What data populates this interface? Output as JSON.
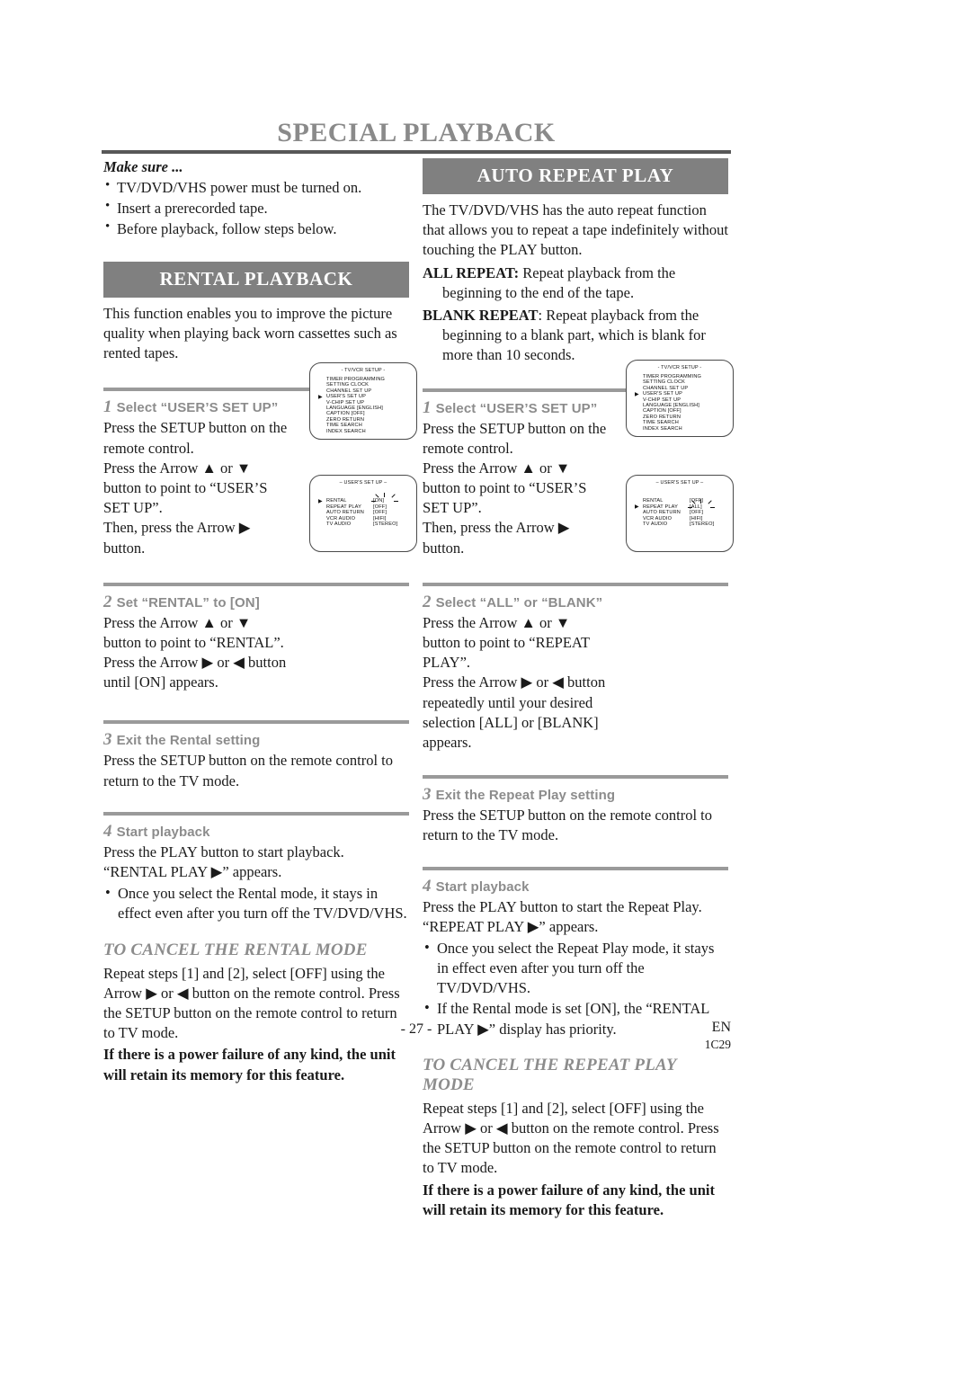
{
  "header": {
    "title": "SPECIAL PLAYBACK"
  },
  "make_sure": {
    "title": "Make sure ...",
    "items": [
      "TV/DVD/VHS power must be turned on.",
      "Insert a prerecorded tape.",
      "Before playback, follow steps below."
    ]
  },
  "rental": {
    "bar_title": "RENTAL PLAYBACK",
    "intro": "This function enables you to improve the picture quality when playing back worn cassettes such as rented tapes.",
    "steps": [
      {
        "num": "1",
        "label": "Select “USER’S SET UP”",
        "lines": [
          "Press the SETUP button on the remote control.",
          "Press the Arrow ▲ or ▼ button to point to “USER’S SET UP”.",
          "Then, press the Arrow ▶ button."
        ]
      },
      {
        "num": "2",
        "label": "Set “RENTAL” to [ON]",
        "lines": [
          "Press the Arrow ▲ or ▼ button to point to “RENTAL”.",
          "Press the Arrow ▶ or ◀ button until [ON] appears."
        ]
      },
      {
        "num": "3",
        "label": "Exit the Rental setting",
        "lines": [
          "Press the SETUP button on the remote control to return to the TV mode."
        ]
      },
      {
        "num": "4",
        "label": "Start playback",
        "lines": [
          "Press the PLAY button to start playback. “RENTAL PLAY ▶” appears."
        ],
        "bullets": [
          "Once you select the Rental mode, it stays in effect even after you turn off the TV/DVD/VHS."
        ]
      }
    ],
    "cancel": {
      "title": "TO CANCEL THE RENTAL MODE",
      "text": "Repeat steps [1] and [2], select [OFF] using the Arrow ▶ or ◀ button on the remote control. Press the SETUP button on the remote control to return to TV mode.",
      "note": "If there is a power failure of any kind, the unit will retain its memory for this feature."
    }
  },
  "repeat": {
    "bar_title": "AUTO REPEAT PLAY",
    "intro": "The TV/DVD/VHS has the auto repeat function that allows you to repeat a tape indefinitely without touching the PLAY button.",
    "all_repeat_label": "ALL REPEAT:",
    "all_repeat_text": " Repeat playback from the beginning to the end of the tape.",
    "blank_repeat_label": "BLANK REPEAT",
    "blank_repeat_text": ": Repeat playback from the beginning to a blank part, which is blank for more than 10 seconds.",
    "steps": [
      {
        "num": "1",
        "label": "Select “USER’S SET UP”",
        "lines": [
          "Press the SETUP button on the remote control.",
          "Press the Arrow ▲ or ▼ button to point to “USER’S SET UP”.",
          "Then, press the Arrow ▶ button."
        ]
      },
      {
        "num": "2",
        "label": "Select “ALL” or “BLANK”",
        "lines": [
          "Press the Arrow ▲ or ▼ button to point to “REPEAT PLAY”.",
          "Press the Arrow ▶ or ◀ button repeatedly until your desired selection [ALL] or [BLANK] appears."
        ]
      },
      {
        "num": "3",
        "label": "Exit the Repeat Play setting",
        "lines": [
          "Press the SETUP button on the remote control to return to the TV mode."
        ]
      },
      {
        "num": "4",
        "label": "Start playback",
        "lines": [
          "Press the PLAY button to start the Repeat Play. “REPEAT PLAY ▶” appears."
        ],
        "bullets": [
          "Once you select the Repeat Play mode, it stays in effect even after you turn off the TV/DVD/VHS.",
          "If the Rental mode is set [ON], the “RENTAL PLAY ▶” display has priority."
        ]
      }
    ],
    "cancel": {
      "title": "TO CANCEL THE REPEAT PLAY MODE",
      "text": "Repeat steps [1] and [2], select [OFF] using the Arrow ▶ or ◀ button on the remote control. Press the SETUP button on the remote control to return to TV mode.",
      "note": "If there is a power failure of any kind, the unit will retain its memory for this feature."
    }
  },
  "osd": {
    "setup_menu": {
      "title": "- TV/VCR SETUP -",
      "items": [
        "TIMER PROGRAMMING",
        "SETTING CLOCK",
        "CHANNEL SET UP",
        "USER'S SET UP",
        "V-CHIP SET UP",
        "LANGUAGE  [ENGLISH]",
        "CAPTION  [OFF]",
        "ZERO RETURN",
        "TIME SEARCH",
        "INDEX SEARCH"
      ],
      "pointer_index": 3,
      "pointer_glyph": "▶"
    },
    "user_setup_rental": {
      "title": "– USER'S SET UP –",
      "rows": [
        {
          "name": "RENTAL",
          "value": "[ON]"
        },
        {
          "name": "REPEAT PLAY",
          "value": "[OFF]"
        },
        {
          "name": "AUTO RETURN",
          "value": "[OFF]"
        },
        {
          "name": "VCR AUDIO",
          "value": "[HIFI]"
        },
        {
          "name": "TV AUDIO",
          "value": "[STEREO]"
        }
      ],
      "pointer_index": 0,
      "highlight_index": 0,
      "pointer_glyph": "▶"
    },
    "user_setup_repeat": {
      "title": "– USER'S SET UP –",
      "rows": [
        {
          "name": "RENTAL",
          "value": "[OFF]"
        },
        {
          "name": "REPEAT PLAY",
          "value": "[ALL]"
        },
        {
          "name": "AUTO RETURN",
          "value": "[OFF]"
        },
        {
          "name": "VCR AUDIO",
          "value": "[HIFI]"
        },
        {
          "name": "TV AUDIO",
          "value": "[STEREO]"
        }
      ],
      "pointer_index": 1,
      "highlight_index": 1,
      "pointer_glyph": "▶"
    }
  },
  "footer": {
    "page_number": "- 27 -",
    "language": "EN",
    "code": "1C29"
  },
  "colors": {
    "bar_gray": "#808080",
    "title_gray": "#8a8a8a",
    "rule_gray": "#9a9a9a",
    "rule_dark": "#585858"
  }
}
